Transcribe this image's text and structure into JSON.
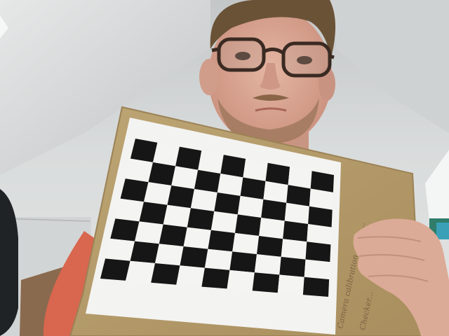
{
  "scene": {
    "description_label": "webcam-calibration-checkerboard",
    "checkerboard": {
      "rows": 7,
      "cols": 9,
      "dark_color": "#161616",
      "light_color": "#f4f4f2"
    },
    "colors": {
      "wall": "#d9dddd",
      "ceiling": "#c9cccc",
      "cardboard": "#b79c68",
      "paper": "#f3f3f1",
      "shirt": "#d9674f",
      "skin": "#d9a894",
      "hair": "#6a5237",
      "glasses": "#3a2a22"
    },
    "handwriting_lines": [
      "Camera calibration ... for ...",
      "Checker..."
    ]
  }
}
